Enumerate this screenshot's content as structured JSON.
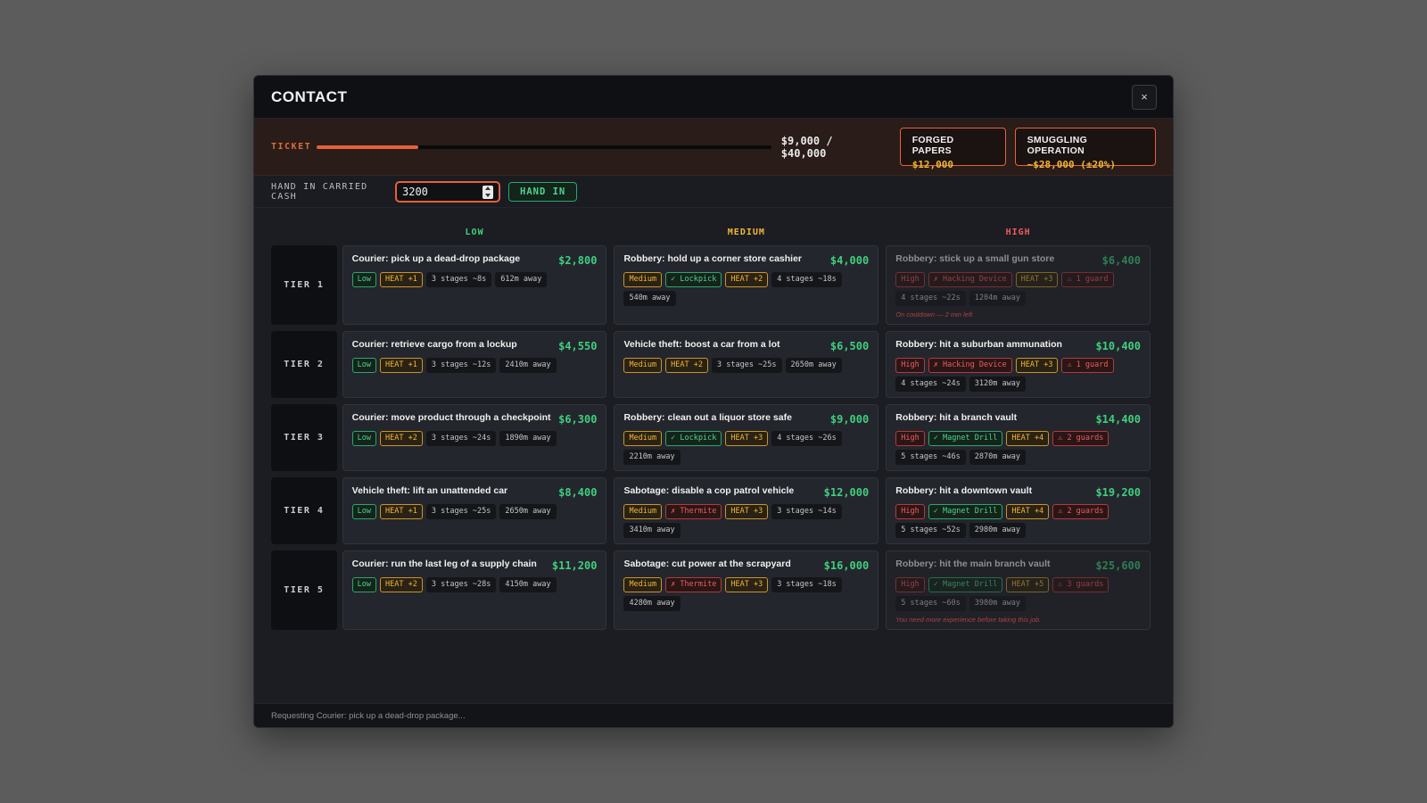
{
  "modal": {
    "title": "CONTACT",
    "close_label": "×"
  },
  "ticket": {
    "label": "TICKET",
    "progress_fraction": 0.225,
    "amount": "$9,000 / $40,000",
    "options": [
      {
        "name": "FORGED PAPERS",
        "price": "$12,000"
      },
      {
        "name": "SMUGGLING OPERATION",
        "price": "~$28,000 (±20%)"
      }
    ]
  },
  "handin": {
    "label": "HAND IN CARRIED CASH",
    "value": "3200",
    "button": "HAND IN"
  },
  "columns": [
    {
      "label": "LOW",
      "color": "#3fcf7e"
    },
    {
      "label": "MEDIUM",
      "color": "#f2b635"
    },
    {
      "label": "HIGH",
      "color": "#ef5b5b"
    }
  ],
  "rows": [
    {
      "tier": "TIER 1",
      "jobs": [
        {
          "title": "Courier: pick up a dead-drop package",
          "price": "$2,800",
          "dim": false,
          "note": "",
          "chips": [
            {
              "t": "Low",
              "k": "low"
            },
            {
              "t": "HEAT +1",
              "k": "heat"
            },
            {
              "t": "3 stages ~8s",
              "k": "info"
            },
            {
              "t": "612m away",
              "k": "info"
            }
          ]
        },
        {
          "title": "Robbery: hold up a corner store cashier",
          "price": "$4,000",
          "dim": false,
          "note": "",
          "chips": [
            {
              "t": "Medium",
              "k": "medium"
            },
            {
              "t": "✓ Lockpick",
              "k": "ok"
            },
            {
              "t": "HEAT +2",
              "k": "heat"
            },
            {
              "t": "4 stages ~18s",
              "k": "info"
            },
            {
              "t": "540m away",
              "k": "info"
            }
          ]
        },
        {
          "title": "Robbery: stick up a small gun store",
          "price": "$6,400",
          "dim": true,
          "note": "On cooldown — 2 min left.",
          "chips": [
            {
              "t": "High",
              "k": "high"
            },
            {
              "t": "✗ Hacking Device",
              "k": "bad"
            },
            {
              "t": "HEAT +3",
              "k": "heat"
            },
            {
              "t": "⚠ 1 guard",
              "k": "guard"
            },
            {
              "t": "4 stages ~22s",
              "k": "info"
            },
            {
              "t": "1204m away",
              "k": "info"
            }
          ]
        }
      ]
    },
    {
      "tier": "TIER 2",
      "jobs": [
        {
          "title": "Courier: retrieve cargo from a lockup",
          "price": "$4,550",
          "dim": false,
          "note": "",
          "chips": [
            {
              "t": "Low",
              "k": "low"
            },
            {
              "t": "HEAT +1",
              "k": "heat"
            },
            {
              "t": "3 stages ~12s",
              "k": "info"
            },
            {
              "t": "2410m away",
              "k": "info"
            }
          ]
        },
        {
          "title": "Vehicle theft: boost a car from a lot",
          "price": "$6,500",
          "dim": false,
          "note": "",
          "chips": [
            {
              "t": "Medium",
              "k": "medium"
            },
            {
              "t": "HEAT +2",
              "k": "heat"
            },
            {
              "t": "3 stages ~25s",
              "k": "info"
            },
            {
              "t": "2650m away",
              "k": "info"
            }
          ]
        },
        {
          "title": "Robbery: hit a suburban ammunation",
          "price": "$10,400",
          "dim": false,
          "note": "",
          "chips": [
            {
              "t": "High",
              "k": "high"
            },
            {
              "t": "✗ Hacking Device",
              "k": "bad"
            },
            {
              "t": "HEAT +3",
              "k": "heat"
            },
            {
              "t": "⚠ 1 guard",
              "k": "guard"
            },
            {
              "t": "4 stages ~24s",
              "k": "info"
            },
            {
              "t": "3120m away",
              "k": "info"
            }
          ]
        }
      ]
    },
    {
      "tier": "TIER 3",
      "jobs": [
        {
          "title": "Courier: move product through a checkpoint",
          "price": "$6,300",
          "dim": false,
          "note": "",
          "chips": [
            {
              "t": "Low",
              "k": "low"
            },
            {
              "t": "HEAT +2",
              "k": "heat"
            },
            {
              "t": "3 stages ~24s",
              "k": "info"
            },
            {
              "t": "1890m away",
              "k": "info"
            }
          ]
        },
        {
          "title": "Robbery: clean out a liquor store safe",
          "price": "$9,000",
          "dim": false,
          "note": "",
          "chips": [
            {
              "t": "Medium",
              "k": "medium"
            },
            {
              "t": "✓ Lockpick",
              "k": "ok"
            },
            {
              "t": "HEAT +3",
              "k": "heat"
            },
            {
              "t": "4 stages ~26s",
              "k": "info"
            },
            {
              "t": "2210m away",
              "k": "info"
            }
          ]
        },
        {
          "title": "Robbery: hit a branch vault",
          "price": "$14,400",
          "dim": false,
          "note": "",
          "chips": [
            {
              "t": "High",
              "k": "high"
            },
            {
              "t": "✓ Magnet Drill",
              "k": "ok"
            },
            {
              "t": "HEAT +4",
              "k": "heat"
            },
            {
              "t": "⚠ 2 guards",
              "k": "guard"
            },
            {
              "t": "5 stages ~46s",
              "k": "info"
            },
            {
              "t": "2870m away",
              "k": "info"
            }
          ]
        }
      ]
    },
    {
      "tier": "TIER 4",
      "jobs": [
        {
          "title": "Vehicle theft: lift an unattended car",
          "price": "$8,400",
          "dim": false,
          "note": "",
          "chips": [
            {
              "t": "Low",
              "k": "low"
            },
            {
              "t": "HEAT +1",
              "k": "heat"
            },
            {
              "t": "3 stages ~25s",
              "k": "info"
            },
            {
              "t": "2650m away",
              "k": "info"
            }
          ]
        },
        {
          "title": "Sabotage: disable a cop patrol vehicle",
          "price": "$12,000",
          "dim": false,
          "note": "",
          "chips": [
            {
              "t": "Medium",
              "k": "medium"
            },
            {
              "t": "✗ Thermite",
              "k": "bad"
            },
            {
              "t": "HEAT +3",
              "k": "heat"
            },
            {
              "t": "3 stages ~14s",
              "k": "info"
            },
            {
              "t": "3410m away",
              "k": "info"
            }
          ]
        },
        {
          "title": "Robbery: hit a downtown vault",
          "price": "$19,200",
          "dim": false,
          "note": "",
          "chips": [
            {
              "t": "High",
              "k": "high"
            },
            {
              "t": "✓ Magnet Drill",
              "k": "ok"
            },
            {
              "t": "HEAT +4",
              "k": "heat"
            },
            {
              "t": "⚠ 2 guards",
              "k": "guard"
            },
            {
              "t": "5 stages ~52s",
              "k": "info"
            },
            {
              "t": "2980m away",
              "k": "info"
            }
          ]
        }
      ]
    },
    {
      "tier": "TIER 5",
      "jobs": [
        {
          "title": "Courier: run the last leg of a supply chain",
          "price": "$11,200",
          "dim": false,
          "note": "",
          "chips": [
            {
              "t": "Low",
              "k": "low"
            },
            {
              "t": "HEAT +2",
              "k": "heat"
            },
            {
              "t": "3 stages ~28s",
              "k": "info"
            },
            {
              "t": "4150m away",
              "k": "info"
            }
          ]
        },
        {
          "title": "Sabotage: cut power at the scrapyard",
          "price": "$16,000",
          "dim": false,
          "note": "",
          "chips": [
            {
              "t": "Medium",
              "k": "medium"
            },
            {
              "t": "✗ Thermite",
              "k": "bad"
            },
            {
              "t": "HEAT +3",
              "k": "heat"
            },
            {
              "t": "3 stages ~18s",
              "k": "info"
            },
            {
              "t": "4280m away",
              "k": "info"
            }
          ]
        },
        {
          "title": "Robbery: hit the main branch vault",
          "price": "$25,600",
          "dim": true,
          "note": "You need more experience before taking this job.",
          "chips": [
            {
              "t": "High",
              "k": "high"
            },
            {
              "t": "✓ Magnet Drill",
              "k": "ok"
            },
            {
              "t": "HEAT +5",
              "k": "heat"
            },
            {
              "t": "⚠ 3 guards",
              "k": "guard"
            },
            {
              "t": "5 stages ~60s",
              "k": "info"
            },
            {
              "t": "3980m away",
              "k": "info"
            }
          ]
        }
      ]
    }
  ],
  "status": "Requesting Courier: pick up a dead-drop package..."
}
